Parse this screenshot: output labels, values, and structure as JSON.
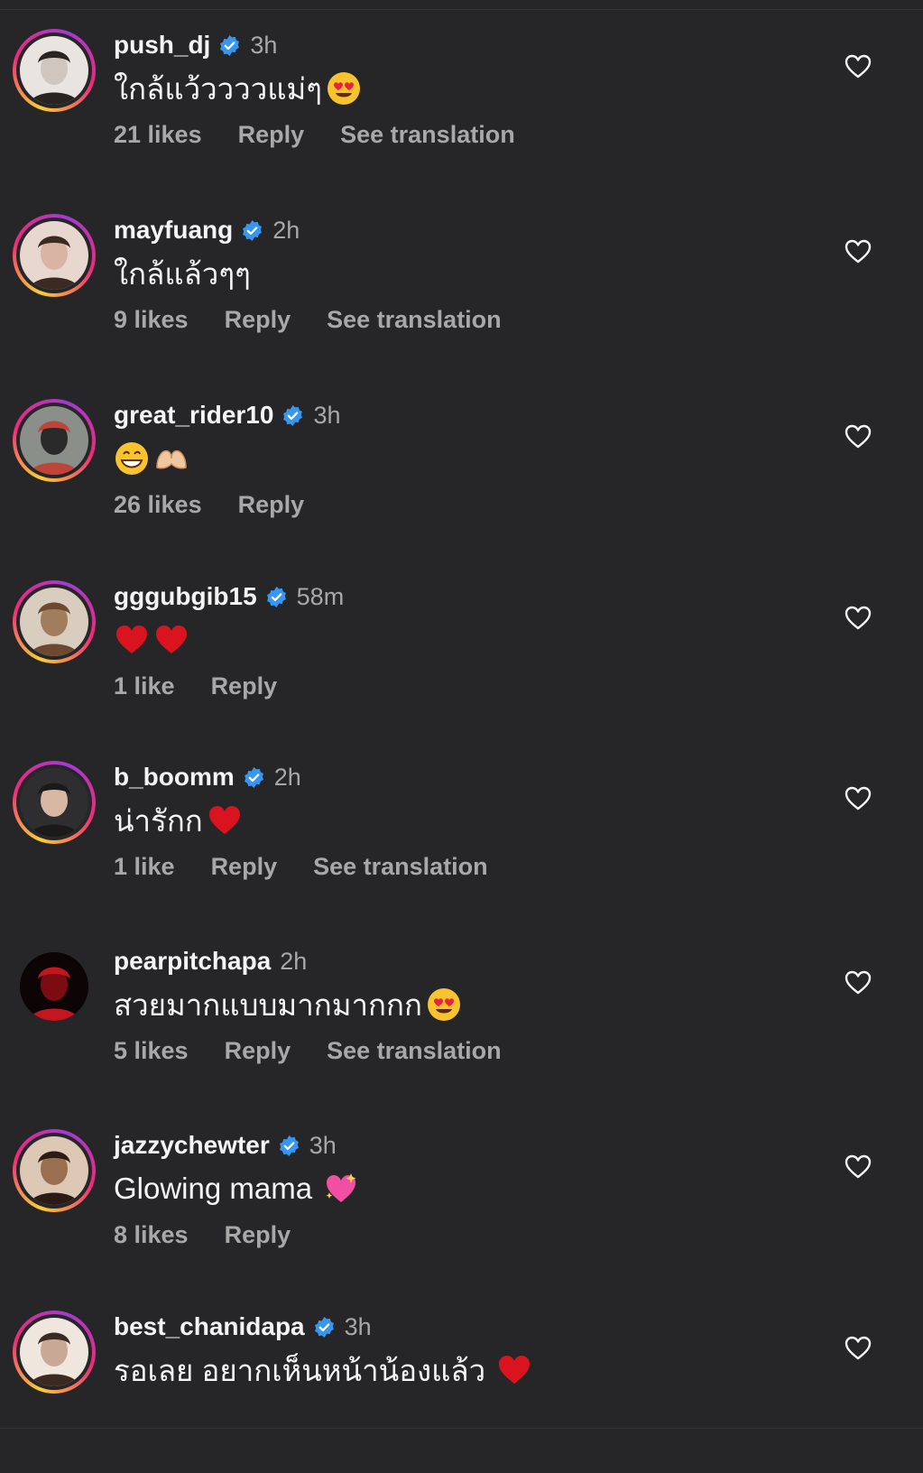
{
  "comments": [
    {
      "username": "push_dj",
      "verified": true,
      "time": "3h",
      "text": "ใกล้แว้ววววแม่ๆ",
      "emojis": [
        "heart-eyes"
      ],
      "likes": "21 likes",
      "reply": "Reply",
      "translate": "See translation",
      "story": true,
      "avatar_colors": [
        "#e9e4e0",
        "#cfc6bf",
        "#2a2420"
      ]
    },
    {
      "username": "mayfuang",
      "verified": true,
      "time": "2h",
      "text": "ใกล้แล้วๆๆ",
      "emojis": [],
      "likes": "9 likes",
      "reply": "Reply",
      "translate": "See translation",
      "story": true,
      "avatar_colors": [
        "#e8d7cf",
        "#d9b4a5",
        "#3a2a22"
      ]
    },
    {
      "username": "great_rider10",
      "verified": true,
      "time": "3h",
      "text": "",
      "emojis": [
        "grin",
        "heart-hands"
      ],
      "likes": "26 likes",
      "reply": "Reply",
      "translate": "",
      "story": true,
      "avatar_colors": [
        "#8b8f8a",
        "#2a2a2a",
        "#c0443a"
      ]
    },
    {
      "username": "gggubgib15",
      "verified": true,
      "time": "58m",
      "text": "",
      "emojis": [
        "red-heart",
        "red-heart"
      ],
      "likes": "1 like",
      "reply": "Reply",
      "translate": "",
      "story": true,
      "avatar_colors": [
        "#d9cdbf",
        "#a07d5c",
        "#6b4a30"
      ]
    },
    {
      "username": "b_boomm",
      "verified": true,
      "time": "2h",
      "text": "น่ารักก",
      "emojis": [
        "red-heart"
      ],
      "likes": "1 like",
      "reply": "Reply",
      "translate": "See translation",
      "story": true,
      "avatar_colors": [
        "#2e2e30",
        "#d8b7a3",
        "#1a1a1a"
      ]
    },
    {
      "username": "pearpitchapa",
      "verified": false,
      "time": "2h",
      "text": "สวยมากแบบมากมากกก",
      "emojis": [
        "heart-eyes"
      ],
      "likes": "5 likes",
      "reply": "Reply",
      "translate": "See translation",
      "story": false,
      "avatar_colors": [
        "#0c0405",
        "#7a0c12",
        "#c4161f"
      ]
    },
    {
      "username": "jazzychewter",
      "verified": true,
      "time": "3h",
      "text": "Glowing mama",
      "emojis": [
        "sparkling-heart"
      ],
      "likes": "8 likes",
      "reply": "Reply",
      "translate": "",
      "story": true,
      "avatar_colors": [
        "#dcc8b5",
        "#9a6f50",
        "#2a1c14"
      ]
    },
    {
      "username": "best_chanidapa",
      "verified": true,
      "time": "3h",
      "text": "รอเลย อยากเห็นหน้าน้องแล้ว",
      "emojis": [
        "red-heart"
      ],
      "likes": "",
      "reply": "",
      "translate": "",
      "story": true,
      "avatar_colors": [
        "#efe6dd",
        "#c9a996",
        "#3a2a22"
      ]
    }
  ],
  "icons": {
    "like": "heart-outline-icon",
    "verified": "verified-badge-icon"
  },
  "colors": {
    "background": "#262628",
    "muted": "#a8a8a8",
    "verified": "#3797f0",
    "text": "#f5f5f5"
  }
}
